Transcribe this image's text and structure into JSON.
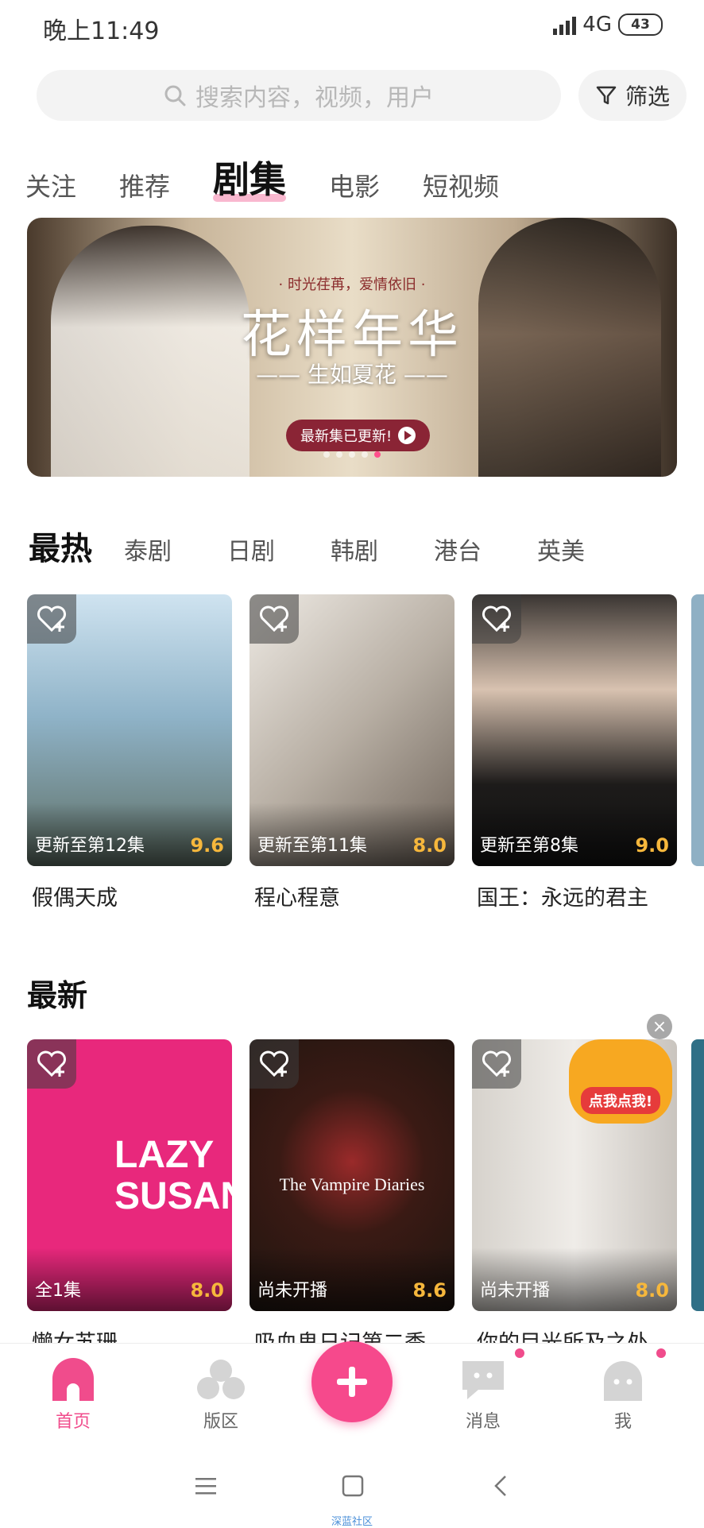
{
  "status": {
    "time": "晚上11:49",
    "network": "4G",
    "battery": "43"
  },
  "search": {
    "placeholder": "搜索内容，视频，用户",
    "filter_label": "筛选"
  },
  "tabs": [
    "关注",
    "推荐",
    "剧集",
    "电影",
    "短视频"
  ],
  "banner": {
    "tagline": "· 时光荏苒，爱情依旧 ·",
    "title": "花样年华",
    "subtitle": "—— 生如夏花 ——",
    "button": "最新集已更新!"
  },
  "categories": [
    "最热",
    "泰剧",
    "日剧",
    "韩剧",
    "港台",
    "英美"
  ],
  "hot": [
    {
      "title": "假偶天成",
      "status": "更新至第12集",
      "score": "9.6",
      "color": "#8fb3c8"
    },
    {
      "title": "程心程意",
      "status": "更新至第11集",
      "score": "8.0",
      "color": "#c9c2b8"
    },
    {
      "title": "国王：永远的君主",
      "status": "更新至第8集",
      "score": "9.0",
      "color": "#2d2a28"
    }
  ],
  "latest_title": "最新",
  "latest": [
    {
      "title": "懒女苏珊",
      "status": "全1集",
      "score": "8.0",
      "color": "#e8287c",
      "overlay": "LAZY SUSAN"
    },
    {
      "title": "吸血鬼日记第二季",
      "status": "尚未开播",
      "score": "8.6",
      "color": "#2a1e1a",
      "overlay": "The Vampire Diaries"
    },
    {
      "title": "你的目光所及之处",
      "status": "尚未开播",
      "score": "8.0",
      "color": "#d9d6d2"
    }
  ],
  "promo": {
    "label": "点我点我!"
  },
  "nav": {
    "home": "首页",
    "board": "版区",
    "messages": "消息",
    "me": "我"
  },
  "watermark": "深蓝社区"
}
